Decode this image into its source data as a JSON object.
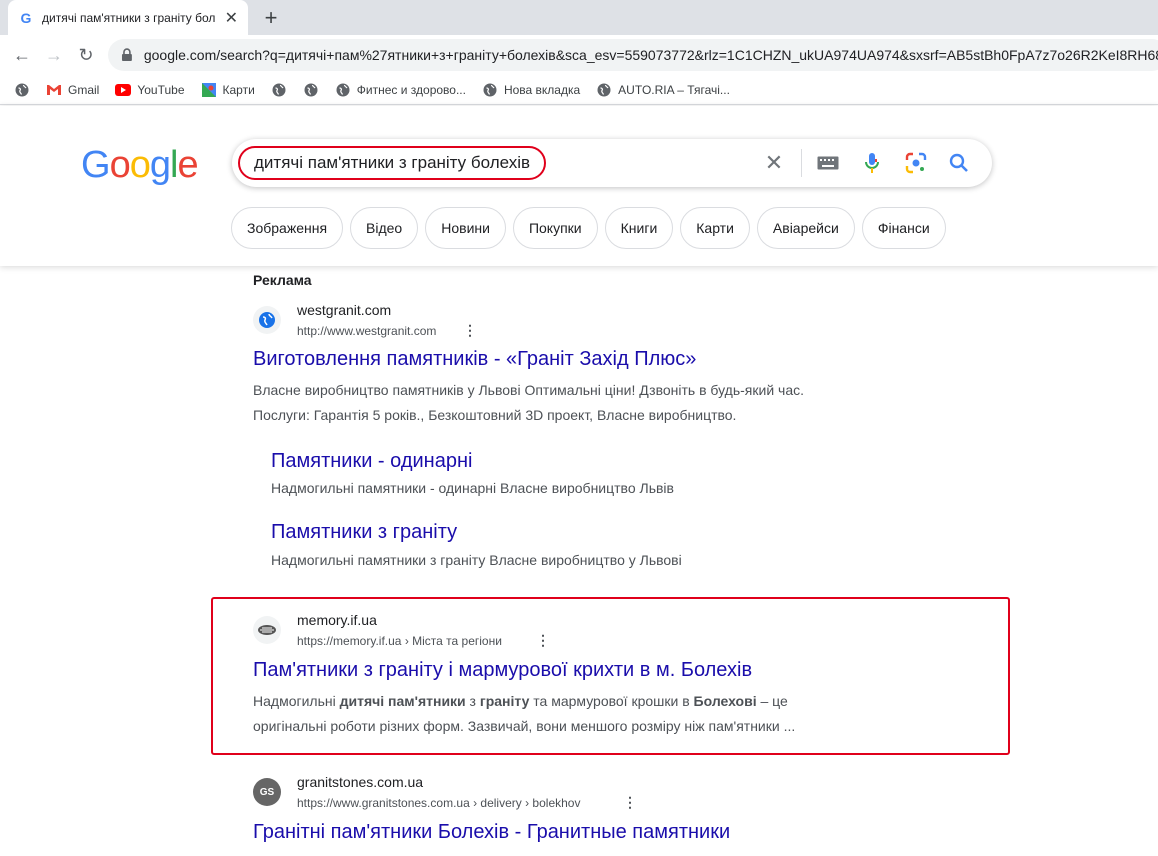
{
  "browser": {
    "tab_title": "дитячі пам'ятники з граніту бол",
    "tab_favicon": "G",
    "url": "google.com/search?q=дитячі+пам%27ятники+з+граніту+болехів&sca_esv=559073772&rlz=1C1CHZN_ukUA974UA974&sxsrf=AB5stBh0FpA7z7o26R2KeI8RH68b1"
  },
  "bookmarks": [
    {
      "label": "",
      "icon": "globe-icon"
    },
    {
      "label": "Gmail",
      "icon": "gmail-icon"
    },
    {
      "label": "YouTube",
      "icon": "youtube-icon"
    },
    {
      "label": "Карти",
      "icon": "maps-icon"
    },
    {
      "label": "",
      "icon": "globe-icon"
    },
    {
      "label": "",
      "icon": "globe-icon"
    },
    {
      "label": "Фитнес и здорово...",
      "icon": "globe-icon"
    },
    {
      "label": "Нова вкладка",
      "icon": "globe-icon"
    },
    {
      "label": "AUTO.RIA – Тягачі...",
      "icon": "globe-icon"
    }
  ],
  "search": {
    "logo": "Google",
    "query": "дитячі пам'ятники з граніту болехів",
    "chips": [
      "Зображення",
      "Відео",
      "Новини",
      "Покупки",
      "Книги",
      "Карти",
      "Авіарейси",
      "Фінанси"
    ]
  },
  "ad": {
    "label": "Реклама",
    "site": "westgranit.com",
    "cite": "http://www.westgranit.com",
    "title": "Виготовлення памятників - «Граніт Захід Плюс»",
    "snippet_line1": "Власне виробництво памятників у Львові Оптимальні ціни! Дзвоніть в будь-який час.",
    "snippet_line2": "Послуги: Гарантія 5 років., Безкоштовний 3D проект, Власне виробництво.",
    "sitelinks": [
      {
        "title": "Памятники - одинарні",
        "desc": "Надмогильні памятники - одинарні Власне виробництво Львів"
      },
      {
        "title": "Памятники з граніту",
        "desc": "Надмогильні памятники з граніту Власне виробництво у Львові"
      }
    ]
  },
  "result1": {
    "site": "memory.if.ua",
    "cite": "https://memory.if.ua › Міста та регіони",
    "title": "Пам'ятники з граніту і мармурової крихти в м. Болехів",
    "s1": "Надмогильні ",
    "s1b": "дитячі пам'ятники",
    "s2": " з ",
    "s2b": "граніту",
    "s3": " та мармурової крошки в ",
    "s3b": "Болехові",
    "s4": " – це",
    "line2": "оригінальні роботи різних форм. Зазвичай, вони меншого розміру ніж пам'ятники ..."
  },
  "result2": {
    "site": "granitstones.com.ua",
    "cite": "https://www.granitstones.com.ua › delivery › bolekhov",
    "favicon_text": "GS",
    "title": "Гранітні пам'ятники Болехів - Гранитные памятники"
  },
  "colors": {
    "link": "#1a0dab",
    "highlight": "#e0001b"
  }
}
